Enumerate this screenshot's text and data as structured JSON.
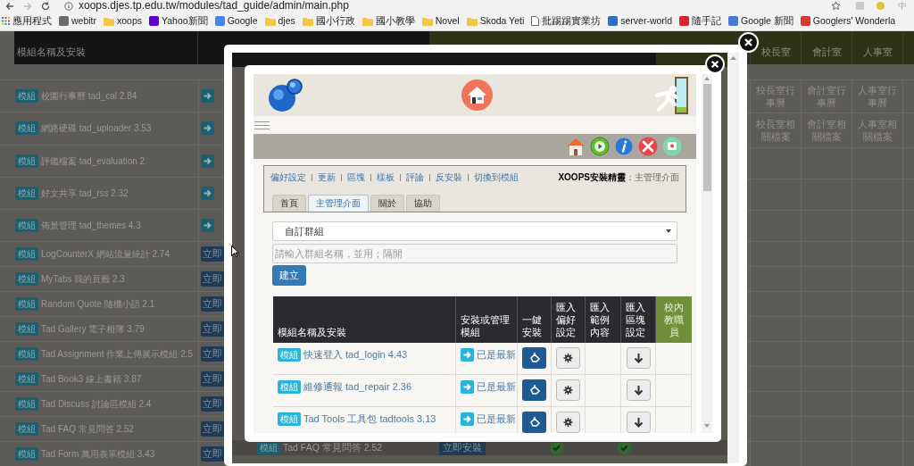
{
  "browser": {
    "url": "xoops.djes.tp.edu.tw/modules/tad_guide/admin/main.php",
    "ime_label": "中",
    "bookmarks": [
      {
        "label": "應用程式",
        "kind": "apps"
      },
      {
        "label": "webitr",
        "kind": "site",
        "color": "#6b6b6b"
      },
      {
        "label": "xoops",
        "kind": "folder"
      },
      {
        "label": "Yahoo新聞",
        "kind": "site",
        "color": "#5f01d1"
      },
      {
        "label": "Google",
        "kind": "site",
        "color": "#4285f4"
      },
      {
        "label": "djes",
        "kind": "folder"
      },
      {
        "label": "國小行政",
        "kind": "folder"
      },
      {
        "label": "國小教學",
        "kind": "folder"
      },
      {
        "label": "Novel",
        "kind": "folder"
      },
      {
        "label": "Skoda Yeti",
        "kind": "folder"
      },
      {
        "label": "批踢踢實業坊",
        "kind": "page"
      },
      {
        "label": "server-world",
        "kind": "site",
        "color": "#2a6fc9"
      },
      {
        "label": "隨手記",
        "kind": "site",
        "color": "#d9252a"
      },
      {
        "label": "Google 新聞",
        "kind": "site",
        "color": "#4a7bd0"
      },
      {
        "label": "Googlers' Wonderla",
        "kind": "site",
        "color": "#d63a2f"
      }
    ]
  },
  "background": {
    "header": "模組名稱及安裝",
    "rows": [
      {
        "badge": "模組",
        "name": "校園行事曆 tad_cal 2.84",
        "action": {
          "kind": "arrow"
        }
      },
      {
        "badge": "模組",
        "name": "網路硬碟 tad_uploader 3.53",
        "action": {
          "kind": "arrow"
        }
      },
      {
        "badge": "模組",
        "name": "評鑑檔案 tad_evaluation 2",
        "action": {
          "kind": "arrow"
        }
      },
      {
        "badge": "模組",
        "name": "好文共享 tad_rss 2.32",
        "action": {
          "kind": "arrow"
        }
      },
      {
        "badge": "模組",
        "name": "佈景管理 tad_themes 4.3",
        "action": {
          "kind": "arrow"
        }
      },
      {
        "badge": "模組",
        "name": "LogCounterX 網站流量統計 2.74",
        "action": {
          "kind": "install",
          "label": "立即"
        }
      },
      {
        "badge": "模組",
        "name": "MyTabs 我的頁籤 2.3",
        "action": {
          "kind": "install",
          "label": "立即"
        }
      },
      {
        "badge": "模組",
        "name": "Random Quote 隨機小語 2.1",
        "action": {
          "kind": "install",
          "label": "立即"
        }
      },
      {
        "badge": "模組",
        "name": "Tad Gallery 電子相簿 3.79",
        "action": {
          "kind": "install",
          "label": "立即"
        }
      },
      {
        "badge": "模組",
        "name": "Tad Assignment 作業上傳展示模組 2.5",
        "action": {
          "kind": "install",
          "label": "立即"
        }
      },
      {
        "badge": "模組",
        "name": "Tad Book3 線上書籍 3.87",
        "action": {
          "kind": "install",
          "label": "立即"
        }
      },
      {
        "badge": "模組",
        "name": "Tad Discuss 討論區模組 2.4",
        "action": {
          "kind": "install",
          "label": "立即"
        }
      },
      {
        "badge": "模組",
        "name": "Tad FAQ 常見問答 2.52",
        "action": {
          "kind": "install",
          "label": "立即"
        }
      },
      {
        "badge": "模組",
        "name": "Tad Form 萬用表單模組 3.43",
        "action": {
          "kind": "install",
          "label": "立即"
        }
      }
    ],
    "office_columns": [
      "校長室",
      "會計室",
      "人事室"
    ],
    "office_rows": [
      [
        "校長室行事曆",
        "會計室行事曆",
        "人事室行事曆"
      ],
      [
        "校長室相關檔案",
        "會計室相關檔案",
        "人事室相關檔案"
      ]
    ]
  },
  "outer_modal": {
    "footer_row": {
      "badge": "模組",
      "name": "Tad FAQ 常見問答 2.52",
      "button": "立即安裝"
    }
  },
  "inner_modal": {
    "admin_links": [
      "偏好設定",
      "更新",
      "區塊",
      "樣板",
      "評論",
      "反安裝",
      "切換到模組"
    ],
    "title": "**XOOPS安裝精靈**：主管理介面",
    "tabs": [
      {
        "label": "首頁",
        "selected": false
      },
      {
        "label": "主管理介面",
        "selected": true
      },
      {
        "label": "關於",
        "selected": false
      },
      {
        "label": "協助",
        "selected": false
      }
    ],
    "group_select": "自訂群組",
    "group_input": {
      "placeholder": "請輸入群組名稱，並用；隔開"
    },
    "create_button": "建立",
    "table": {
      "columns": [
        {
          "label": "模組名稱及安裝",
          "kind": "module"
        },
        {
          "label": "安裝或管理模組",
          "kind": "module"
        },
        {
          "label": "一鍵安裝",
          "kind": "module"
        },
        {
          "label": "匯入偏好設定",
          "kind": "module"
        },
        {
          "label": "匯入範例內容",
          "kind": "module"
        },
        {
          "label": "匯入區塊設定",
          "kind": "module"
        },
        {
          "label": "校內教職員",
          "kind": "group"
        }
      ],
      "rows": [
        {
          "badge": "模組",
          "name": "快速登入 tad_login 4.43",
          "status": "已是最新"
        },
        {
          "badge": "模組",
          "name": "維修通報 tad_repair 2.36",
          "status": "已是最新"
        },
        {
          "badge": "模組",
          "name": "Tad Tools 工具包 tadtools 3.13",
          "status": "已是最新"
        }
      ]
    }
  }
}
